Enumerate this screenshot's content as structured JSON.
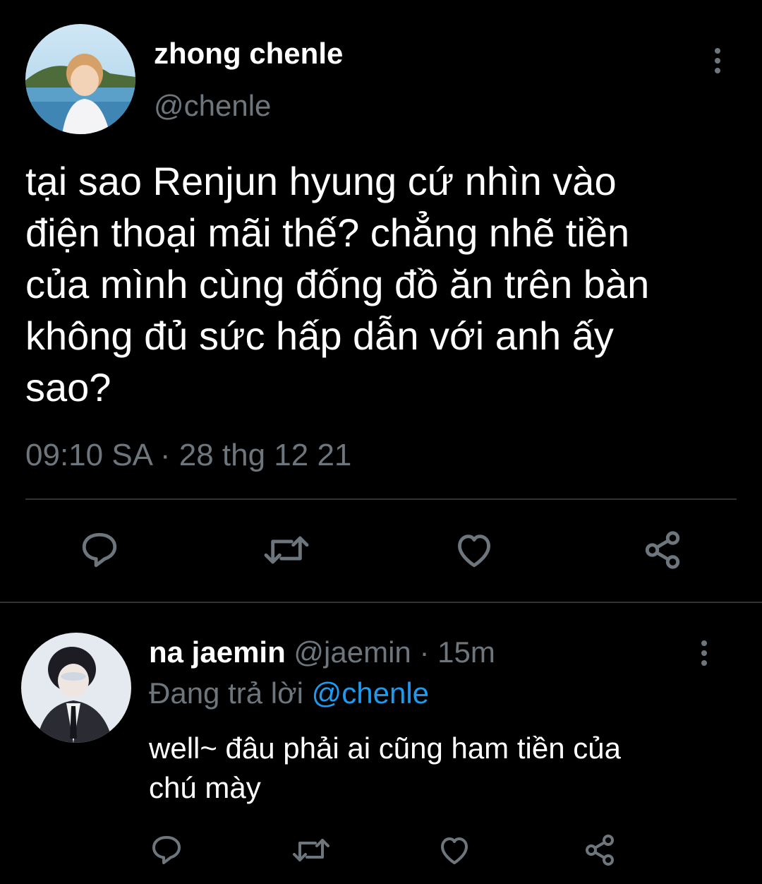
{
  "colors": {
    "background": "#000000",
    "text": "#ffffff",
    "muted": "#6e767d",
    "accent": "#1d9bf0",
    "divider": "#2f3336"
  },
  "main_tweet": {
    "display_name": "zhong chenle",
    "handle": "@chenle",
    "text_lines": [
      "tại sao Renjun hyung cứ nhìn vào",
      "điện thoại mãi thế? chẳng nhẽ tiền",
      "của mình cùng đống đồ ăn trên bàn",
      "không đủ sức hấp dẫn với anh ấy",
      "sao?"
    ],
    "time": "09:10 SA",
    "separator": "·",
    "date": "28 thg 12 21",
    "actions": [
      "reply-icon",
      "retweet-icon",
      "like-icon",
      "share-icon"
    ],
    "more_icon": "more-vertical-icon"
  },
  "reply_tweet": {
    "display_name": "na jaemin",
    "handle": "@jaemin",
    "separator": "·",
    "time_ago": "15m",
    "replying_prefix": "Đang trả lời",
    "replying_to": "@chenle",
    "text_lines": [
      "well~ đâu phải ai cũng ham tiền của",
      "chú mày"
    ],
    "actions": [
      "reply-icon",
      "retweet-icon",
      "like-icon",
      "share-icon"
    ],
    "more_icon": "more-vertical-icon"
  }
}
